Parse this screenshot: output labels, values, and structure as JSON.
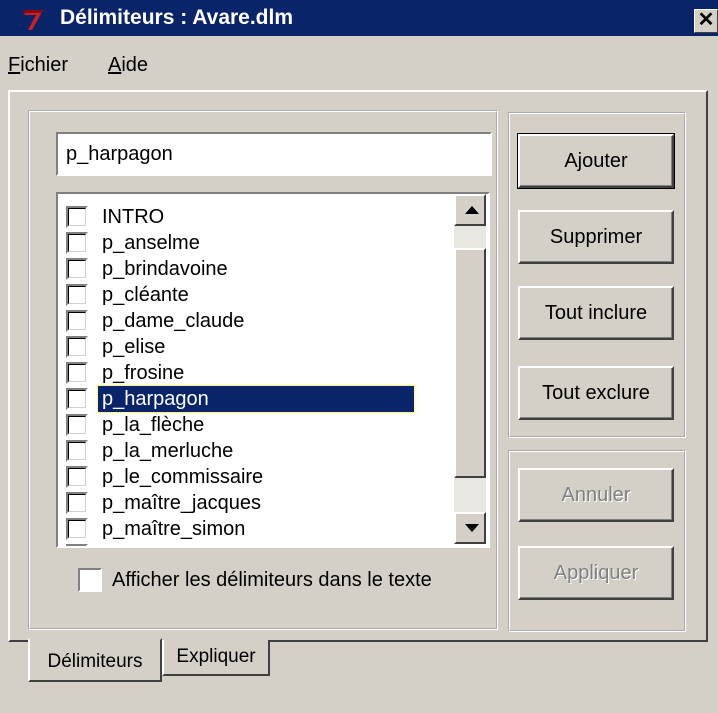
{
  "window": {
    "title": "Délimiteurs : Avare.dlm",
    "close": "✕",
    "app_icon": "app-logo-7-icon",
    "accent": "#0a246a"
  },
  "menu": {
    "fichier_first": "F",
    "fichier_rest": "ichier",
    "aide_first": "A",
    "aide_rest": "ide"
  },
  "input": {
    "value": "p_harpagon"
  },
  "list": {
    "items": [
      "INTRO",
      "p_anselme",
      "p_brindavoine",
      "p_cléante",
      "p_dame_claude",
      "p_elise",
      "p_frosine",
      "p_harpagon",
      "p_la_flèche",
      "p_la_merluche",
      "p_le_commissaire",
      "p_maître_jacques",
      "p_maître_simon"
    ],
    "selected": "p_harpagon"
  },
  "buttons": {
    "ajouter": "Ajouter",
    "supprimer": "Supprimer",
    "tout_inclure": "Tout inclure",
    "tout_exclure": "Tout exclure",
    "annuler": "Annuler",
    "appliquer": "Appliquer"
  },
  "show_checkbox": {
    "label": "Afficher les délimiteurs dans le texte",
    "checked": false
  },
  "tabs": {
    "delimiteurs": "Délimiteurs",
    "expliquer": "Expliquer"
  }
}
